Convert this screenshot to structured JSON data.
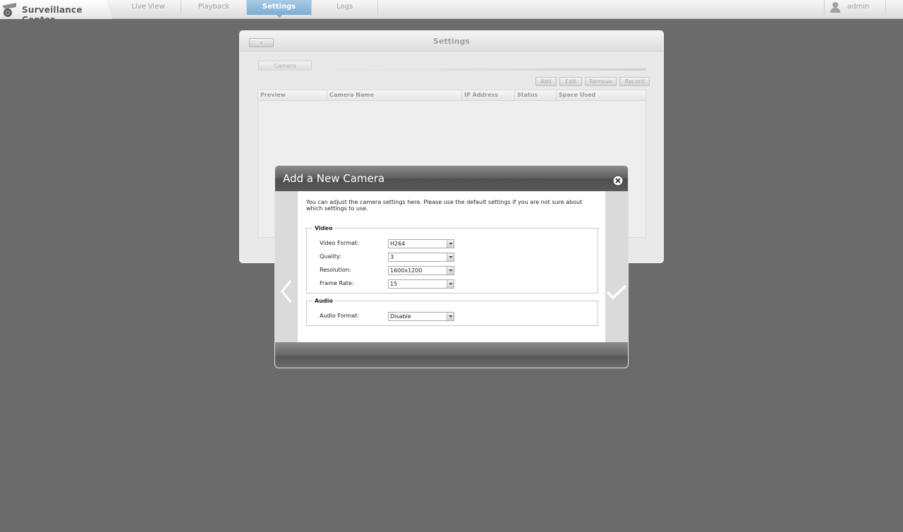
{
  "app": {
    "title": "Surveillance Center",
    "nav_tabs": [
      {
        "label": "Live View",
        "active": false
      },
      {
        "label": "Playback",
        "active": false
      },
      {
        "label": "Settings",
        "active": true
      },
      {
        "label": "Logs",
        "active": false
      }
    ],
    "user": {
      "name": "admin",
      "icon": "user-icon"
    }
  },
  "settings": {
    "title": "Settings",
    "back_label": "‹",
    "tab_label": "Camera",
    "actions": [
      "Add",
      "Edit",
      "Remove",
      "Record"
    ],
    "columns": [
      "Preview",
      "Camera Name",
      "IP Address",
      "Status",
      "Space Used"
    ],
    "rows": []
  },
  "modal": {
    "title": "Add a New Camera",
    "intro": "You can adjust the camera settings here. Please use the default settings if you are not sure about which settings to use.",
    "video": {
      "legend": "Video",
      "fields": [
        {
          "label": "Video Format:",
          "value": "H264"
        },
        {
          "label": "Quality:",
          "value": "3"
        },
        {
          "label": "Resolution:",
          "value": "1600x1200"
        },
        {
          "label": "Frame Rate:",
          "value": "15"
        }
      ]
    },
    "audio": {
      "legend": "Audio",
      "fields": [
        {
          "label": "Audio Format:",
          "value": "Disable"
        }
      ]
    },
    "icons": {
      "close": "close-icon",
      "prev": "chevron-left-icon",
      "confirm": "checkmark-icon"
    }
  },
  "colors": {
    "background": "#6b6b6b",
    "active_tab": "#7aaed3",
    "modal_header": "#5d5d5d"
  }
}
